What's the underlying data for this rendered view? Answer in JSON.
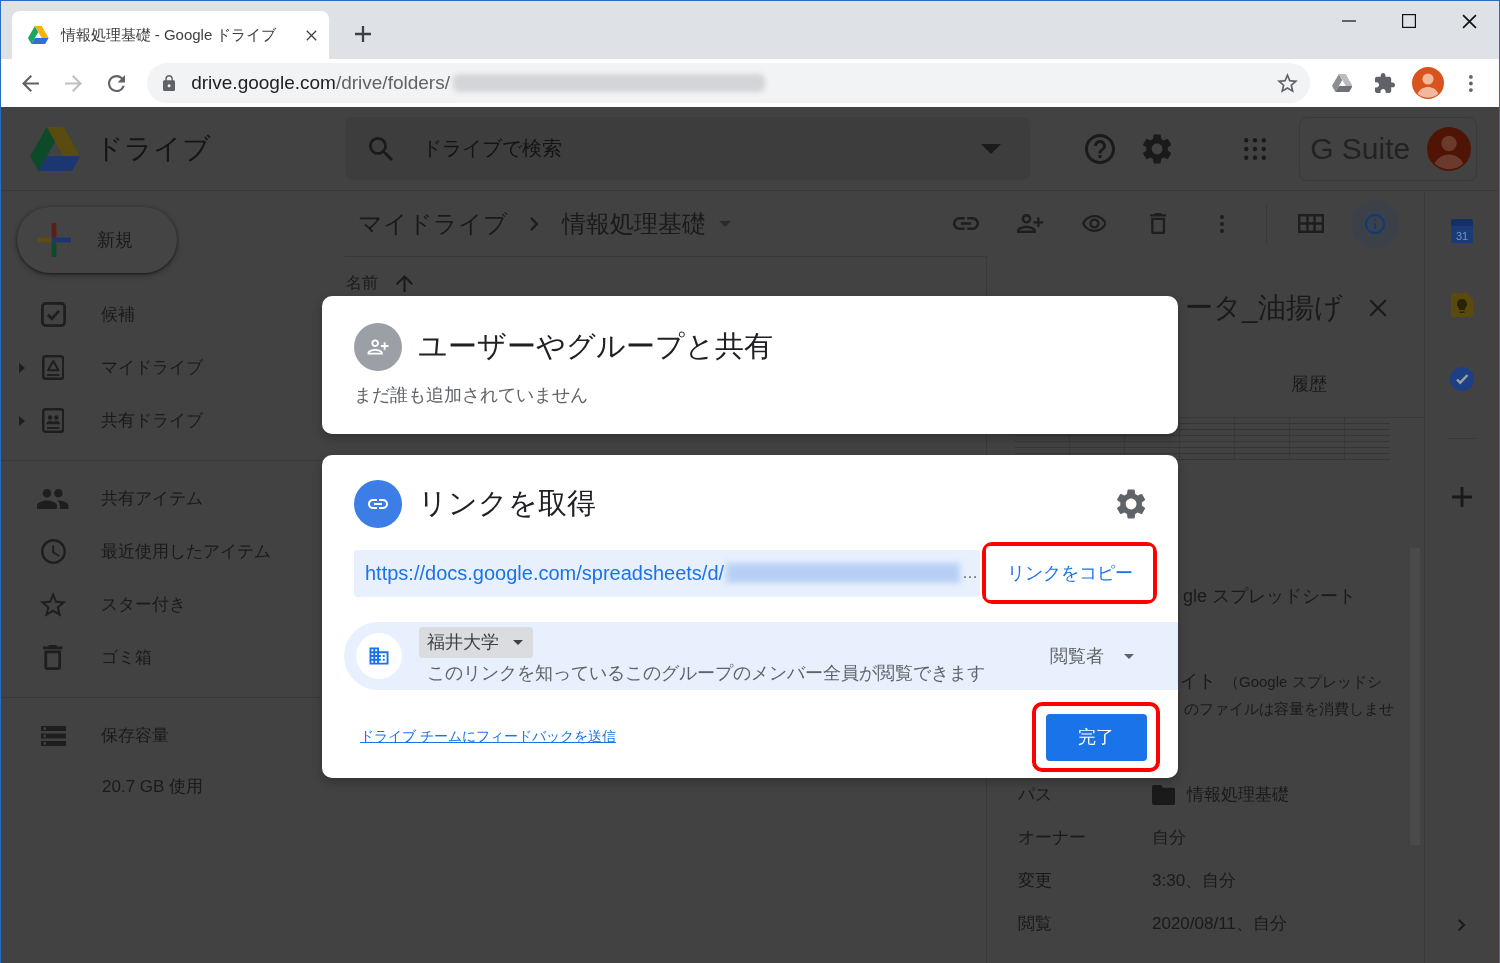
{
  "browser": {
    "tab": {
      "title": "情報処理基礎 - Google ドライブ"
    },
    "nav": [
      {
        "kind": "back",
        "disabled": false
      },
      {
        "kind": "forward",
        "disabled": true
      },
      {
        "kind": "reload",
        "disabled": false
      }
    ],
    "address": {
      "host": "drive.google.com",
      "path": "/drive/folders/"
    }
  },
  "drive": {
    "header": {
      "product": "ドライブ",
      "search": {
        "placeholder": "ドライブで検索"
      },
      "suite": "G Suite"
    },
    "new_button": {
      "label": "新規"
    },
    "nav_sections": [
      {
        "items": [
          {
            "kind": "suggested",
            "label": "候補",
            "expandable": false
          },
          {
            "kind": "my_drive",
            "label": "マイドライブ",
            "expandable": true
          },
          {
            "kind": "shared_drives",
            "label": "共有ドライブ",
            "expandable": true
          }
        ]
      },
      {
        "items": [
          {
            "kind": "shared",
            "label": "共有アイテム",
            "expandable": false
          },
          {
            "kind": "recent",
            "label": "最近使用したアイテム",
            "expandable": false
          },
          {
            "kind": "starred",
            "label": "スター付き",
            "expandable": false
          },
          {
            "kind": "trash",
            "label": "ゴミ箱",
            "expandable": false
          }
        ]
      },
      {
        "items": [
          {
            "kind": "storage",
            "label": "保存容量",
            "expandable": false
          }
        ]
      }
    ],
    "storage_usage": "20.7 GB 使用",
    "breadcrumb": [
      {
        "label": "マイドライブ"
      },
      {
        "label": "情報処理基礎"
      }
    ],
    "toolbar": [
      {
        "kind": "link",
        "selected": false
      },
      {
        "kind": "add_person",
        "selected": false
      },
      {
        "kind": "preview",
        "selected": false
      },
      {
        "kind": "trash",
        "selected": false
      },
      {
        "kind": "more",
        "selected": false
      },
      {
        "kind": "grid",
        "selected": false
      },
      {
        "kind": "info",
        "selected": true
      }
    ],
    "list_header": {
      "label": "名前",
      "sort_ascending": true
    },
    "details": {
      "title": "ータ_油揚げ",
      "tabs": [
        {
          "label": "履歴",
          "selected": false
        }
      ],
      "rows": [
        {
          "kind": "fragment",
          "text": "gle スプレッドシート"
        },
        {
          "kind": "size",
          "value": "イト",
          "note_lines": [
            "（Google スプレッドシ",
            "のファイルは容量を消費しませ"
          ]
        },
        {
          "kind": "path",
          "label": "パス",
          "value": "情報処理基礎"
        },
        {
          "kind": "field",
          "label": "オーナー",
          "value": "自分"
        },
        {
          "kind": "field",
          "label": "変更",
          "value": "3:30、自分"
        },
        {
          "kind": "field",
          "label": "閲覧",
          "value": "2020/08/11、自分"
        }
      ]
    },
    "side_apps": [
      {
        "kind": "calendar",
        "label": "31"
      },
      {
        "kind": "keep"
      },
      {
        "kind": "tasks"
      }
    ]
  },
  "dialog": {
    "share": {
      "title": "ユーザーやグループと共有",
      "subtitle": "まだ誰も追加されていません"
    },
    "link": {
      "title": "リンクを取得",
      "url": "https://docs.google.com/spreadsheets/d/",
      "ellipsis": "…",
      "copy_button": {
        "label": "リンクをコピー",
        "highlighted": true
      },
      "access": {
        "group": "福井大学",
        "description": "このリンクを知っているこのグループのメンバー全員が閲覧できます",
        "role": "閲覧者"
      },
      "feedback_link": "ドライブ チームにフィードバックを送信",
      "done_button": {
        "label": "完了",
        "highlighted": true
      }
    }
  }
}
